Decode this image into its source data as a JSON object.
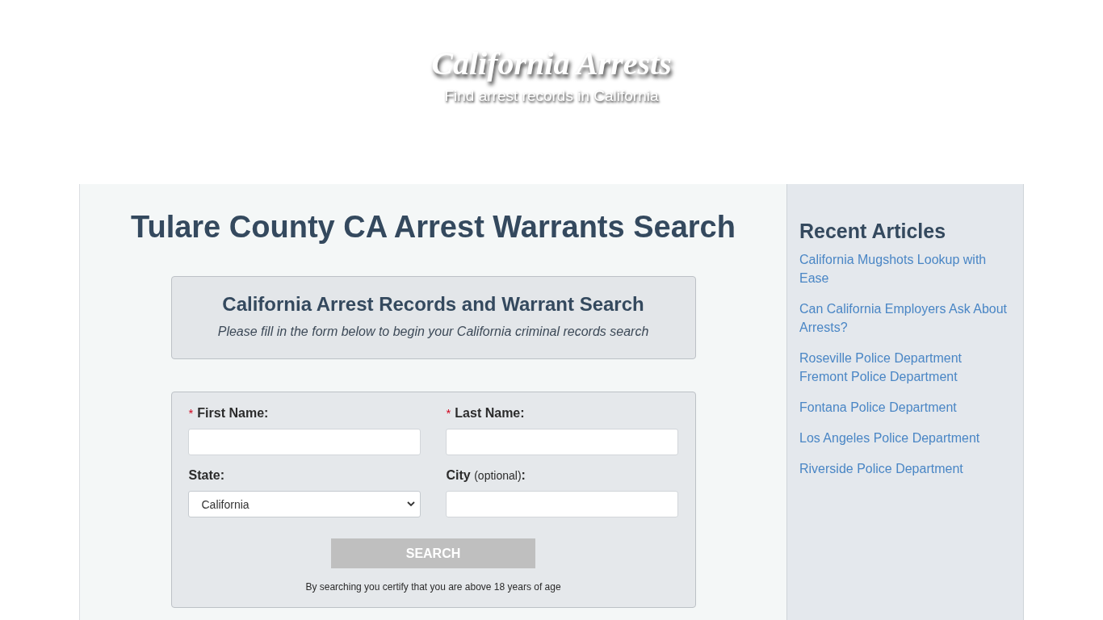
{
  "header": {
    "title": "California Arrests",
    "tagline": "Find arrest records in California"
  },
  "main": {
    "heading": "Tulare County CA Arrest Warrants Search",
    "intro_box": {
      "title": "California Arrest Records and Warrant Search",
      "subtitle": "Please fill in the form below to begin your California criminal records search"
    },
    "search_form": {
      "required_mark": "*",
      "fields": [
        {
          "kind": "text",
          "label": "First Name:",
          "required": true
        },
        {
          "kind": "text",
          "label": "Last Name:",
          "required": true
        },
        {
          "kind": "select",
          "label": "State:",
          "required": false,
          "value": "California"
        },
        {
          "kind": "text",
          "label": "City",
          "note": "(optional)**:**",
          "required": false
        }
      ],
      "button": "SEARCH",
      "disclaimer": "By searching you certify that you are above 18 years of age"
    }
  },
  "sidebar": {
    "title": "Recent Articles",
    "articles": [
      {
        "links": [
          "California Mugshots Lookup with Ease"
        ]
      },
      {
        "links": [
          "Can California Employers Ask About Arrests?"
        ]
      },
      {
        "links": [
          "Roseville Police Department",
          "Fremont Police Department"
        ]
      },
      {
        "links": [
          "Fontana Police Department"
        ]
      },
      {
        "links": [
          "Los Angeles Police Department"
        ]
      },
      {
        "links": [
          "Riverside Police Department"
        ]
      }
    ]
  }
}
